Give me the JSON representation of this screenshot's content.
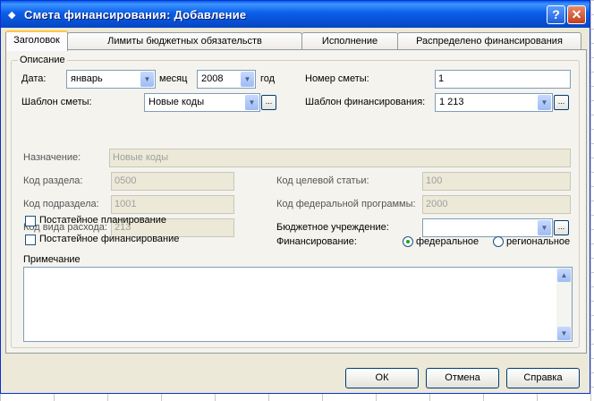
{
  "window": {
    "title": "Смета финансирования: Добавление",
    "help_label": "?",
    "close_label": "✕"
  },
  "tabs": [
    {
      "label": "Заголовок",
      "active": true
    },
    {
      "label": "Лимиты бюджетных обязательств",
      "active": false
    },
    {
      "label": "Исполнение",
      "active": false
    },
    {
      "label": "Распределено финансирования",
      "active": false
    }
  ],
  "group_label": "Описание",
  "date": {
    "label": "Дата:",
    "month": "январь",
    "month_label": "месяц",
    "year": "2008",
    "year_label": "год"
  },
  "estimate_number": {
    "label": "Номер сметы:",
    "value": "1"
  },
  "estimate_template": {
    "label": "Шаблон сметы:",
    "value": "Новые коды"
  },
  "funding_template": {
    "label": "Шаблон финансирования:",
    "value": "1 213"
  },
  "purpose": {
    "label": "Назначение:",
    "value": "Новые коды"
  },
  "section_code": {
    "label": "Код раздела:",
    "value": "0500"
  },
  "target_code": {
    "label": "Код целевой статьи:",
    "value": "100"
  },
  "subsection_code": {
    "label": "Код подраздела:",
    "value": "1001"
  },
  "federal_program_code": {
    "label": "Код федеральной программы:",
    "value": "2000"
  },
  "expense_type_code": {
    "label": "Код вида расхода:",
    "value": "213"
  },
  "budget_institution": {
    "label": "Бюджетное учреждение:",
    "value": ""
  },
  "itemized_planning": {
    "label": "Постатейное планирование",
    "checked": false
  },
  "itemized_financing": {
    "label": "Постатейное финансирование",
    "checked": false
  },
  "financing": {
    "label": "Финансирование:",
    "options": [
      "федеральное",
      "региональное"
    ],
    "selected": "федеральное"
  },
  "note": {
    "label": "Примечание",
    "value": ""
  },
  "buttons": {
    "ok": "ОК",
    "cancel": "Отмена",
    "help": "Справка"
  },
  "colors": {
    "titlebar": "#0a5ee8",
    "dialog_bg": "#ece9d8",
    "active_tab_accent": "#ffc83c"
  }
}
